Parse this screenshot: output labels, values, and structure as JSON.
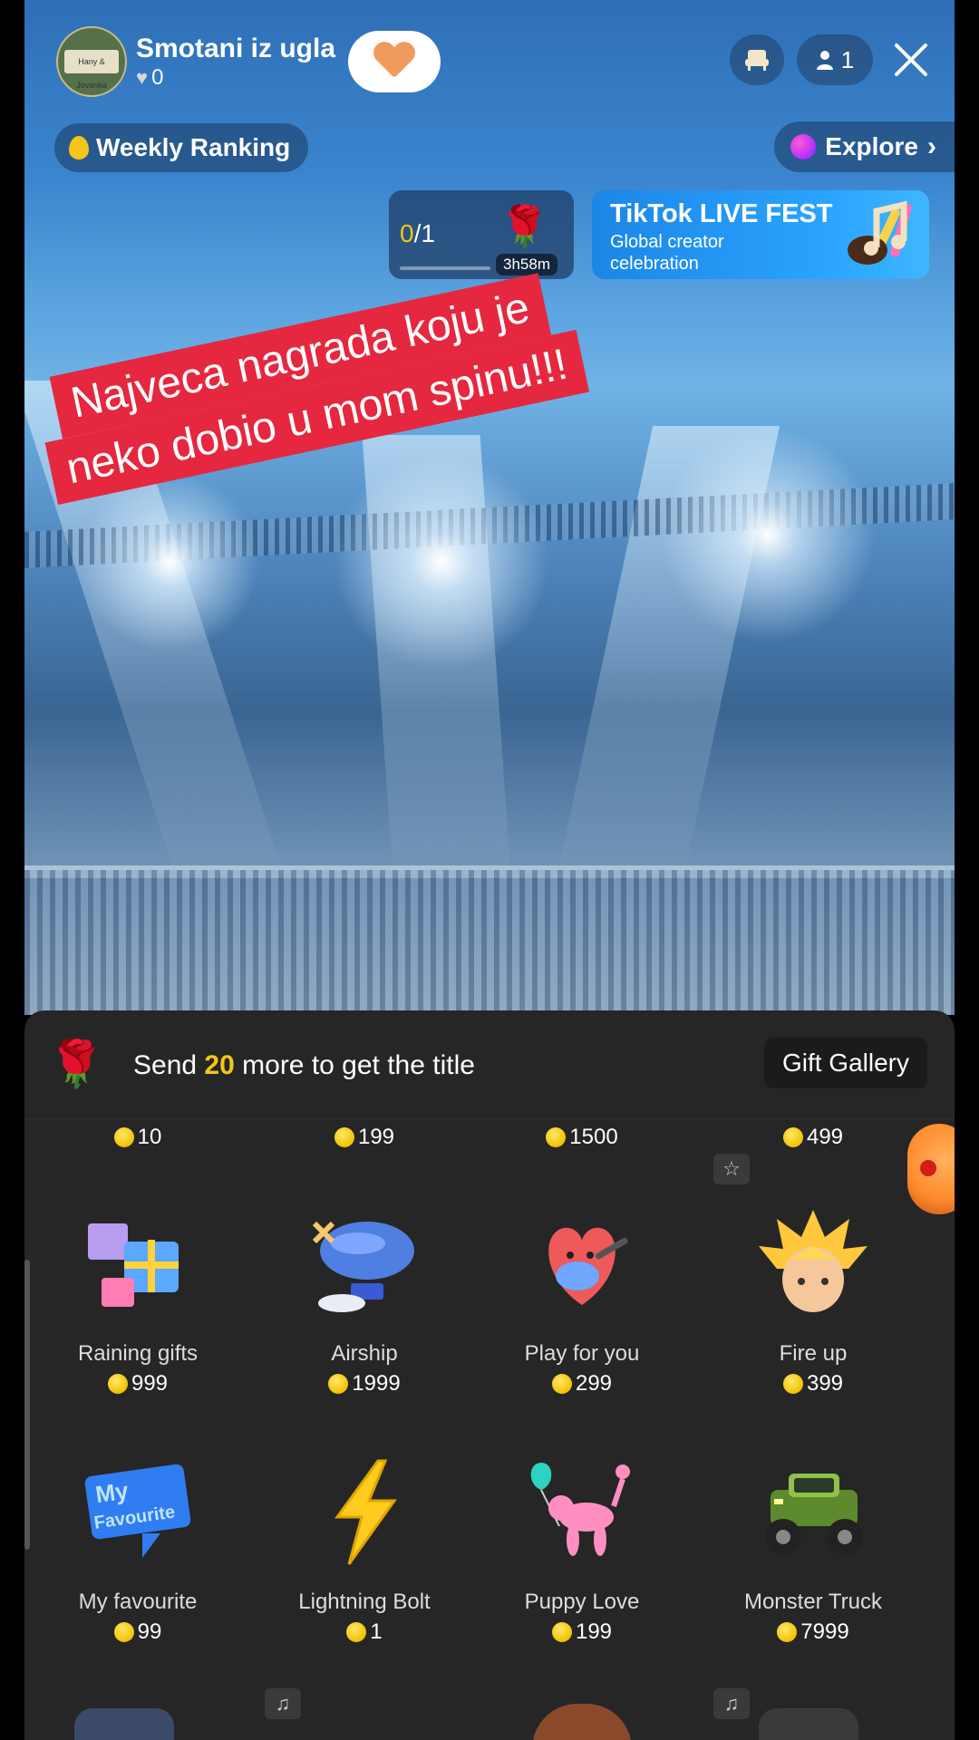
{
  "header": {
    "host_name": "Smotani iz ugla",
    "likes": "0",
    "avatar_text": "Hany & Jovanka",
    "follow_icon": "heart-icon",
    "viewer_count": "1",
    "seat_icon": "seat-icon",
    "close_icon": "close-icon"
  },
  "ranking": {
    "label": "Weekly Ranking"
  },
  "explore": {
    "label": "Explore"
  },
  "goal": {
    "current": "0",
    "total": "/1",
    "timer": "3h58m",
    "icon": "rose-icon"
  },
  "fest": {
    "title": "TikTok LIVE FEST",
    "subtitle": "Global creator celebration"
  },
  "caption": {
    "line1": "Najveca nagrada koju je",
    "line2": "neko dobio u mom spinu!!!"
  },
  "gift_panel": {
    "head_prefix": "Send",
    "head_number": "20",
    "head_suffix": "more to get the title",
    "gallery_button": "Gift Gallery",
    "previous_row_prices": [
      "10",
      "199",
      "1500",
      "499"
    ],
    "gifts": [
      {
        "name": "Raining gifts",
        "price": "999",
        "icon": "gift-boxes-icon"
      },
      {
        "name": "Airship",
        "price": "1999",
        "icon": "airship-icon"
      },
      {
        "name": "Play for you",
        "price": "299",
        "icon": "heart-guitar-icon"
      },
      {
        "name": "Fire up",
        "price": "399",
        "icon": "fire-hair-icon"
      },
      {
        "name": "My favourite",
        "price": "99",
        "icon": "my-favourite-sign-icon"
      },
      {
        "name": "Lightning Bolt",
        "price": "1",
        "icon": "lightning-bolt-icon"
      },
      {
        "name": "Puppy Love",
        "price": "199",
        "icon": "balloon-dog-icon"
      },
      {
        "name": "Monster Truck",
        "price": "7999",
        "icon": "monster-truck-icon"
      }
    ]
  },
  "colors": {
    "accent_yellow": "#f5c518",
    "caption_red": "#e5283f",
    "panel_bg": "#262626"
  }
}
